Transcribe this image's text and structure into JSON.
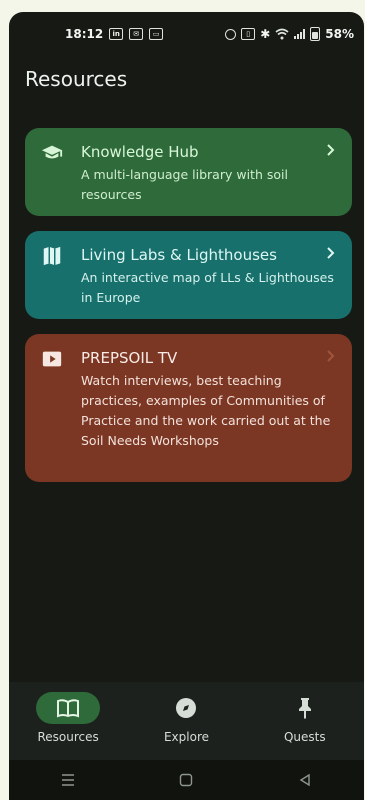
{
  "status_bar": {
    "time": "18:12",
    "left_icons": [
      "linkedin-icon",
      "mail-icon",
      "message-icon"
    ],
    "battery_text": "58%",
    "right_icons": [
      "alarm-icon",
      "vibrate-icon",
      "bluetooth-icon",
      "wifi-icon",
      "signal-icon",
      "battery-icon"
    ]
  },
  "page": {
    "title": "Resources"
  },
  "cards": [
    {
      "id": "knowledge-hub",
      "title": "Knowledge Hub",
      "description": "A multi-language library with soil resources",
      "icon": "graduation-cap-icon",
      "color": "#2f6a3a"
    },
    {
      "id": "living-labs",
      "title": "Living Labs & Lighthouses",
      "description": "An interactive map of LLs & Lighthouses in Europe",
      "icon": "map-icon",
      "color": "#17706b"
    },
    {
      "id": "prepsoil-tv",
      "title": "PREPSOIL TV",
      "description": "Watch interviews, best teaching practices, examples of Communities of Practice and the work carried out at the Soil Needs Workshops",
      "icon": "video-play-icon",
      "color": "#7b3723"
    }
  ],
  "bottom_nav": {
    "items": [
      {
        "label": "Resources",
        "icon": "book-icon",
        "active": true
      },
      {
        "label": "Explore",
        "icon": "compass-icon",
        "active": false
      },
      {
        "label": "Quests",
        "icon": "pin-icon",
        "active": false
      }
    ]
  },
  "system_nav": [
    "recents-icon",
    "home-icon",
    "back-icon"
  ]
}
